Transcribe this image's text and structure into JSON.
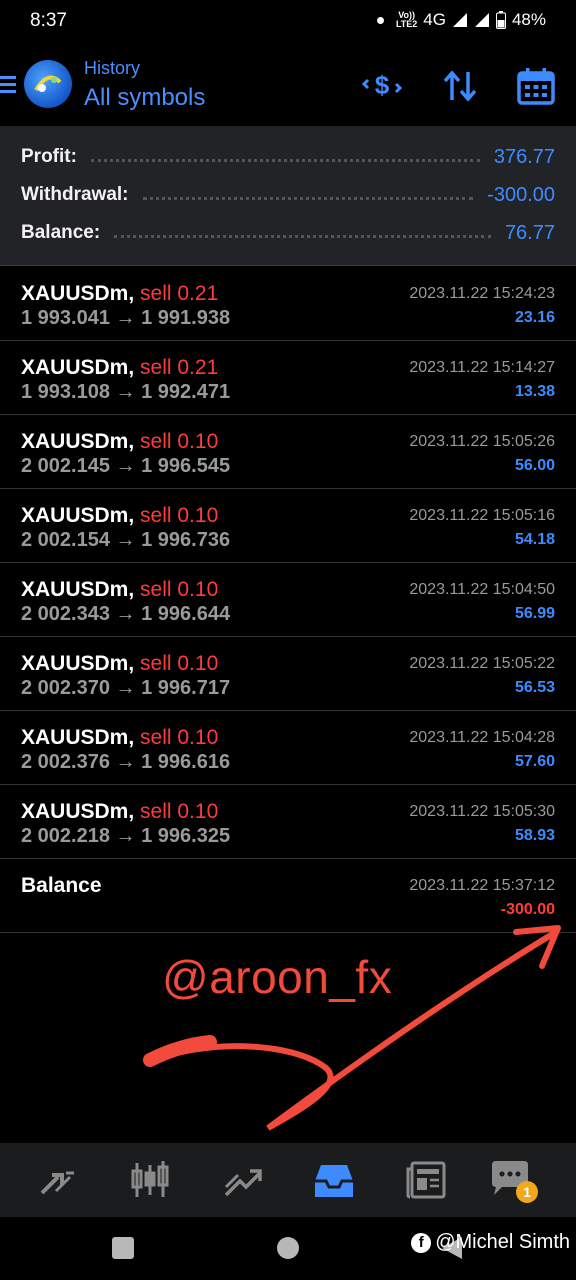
{
  "status": {
    "time": "8:37",
    "volte_top": "Vo))",
    "volte_bottom": "LTE2",
    "network": "4G",
    "battery": "48%"
  },
  "header": {
    "subtitle": "History",
    "title": "All symbols"
  },
  "summary": [
    {
      "label": "Profit:",
      "value": "376.77"
    },
    {
      "label": "Withdrawal:",
      "value": "-300.00"
    },
    {
      "label": "Balance:",
      "value": "76.77"
    }
  ],
  "trades": [
    {
      "symbol": "XAUUSDm,",
      "side": "sell 0.21",
      "prices": "1 993.041 → 1 991.938",
      "time": "2023.11.22 15:24:23",
      "profit": "23.16"
    },
    {
      "symbol": "XAUUSDm,",
      "side": "sell 0.21",
      "prices": "1 993.108 → 1 992.471",
      "time": "2023.11.22 15:14:27",
      "profit": "13.38"
    },
    {
      "symbol": "XAUUSDm,",
      "side": "sell 0.10",
      "prices": "2 002.145 → 1 996.545",
      "time": "2023.11.22 15:05:26",
      "profit": "56.00"
    },
    {
      "symbol": "XAUUSDm,",
      "side": "sell 0.10",
      "prices": "2 002.154 → 1 996.736",
      "time": "2023.11.22 15:05:16",
      "profit": "54.18"
    },
    {
      "symbol": "XAUUSDm,",
      "side": "sell 0.10",
      "prices": "2 002.343 → 1 996.644",
      "time": "2023.11.22 15:04:50",
      "profit": "56.99"
    },
    {
      "symbol": "XAUUSDm,",
      "side": "sell 0.10",
      "prices": "2 002.370 → 1 996.717",
      "time": "2023.11.22 15:05:22",
      "profit": "56.53"
    },
    {
      "symbol": "XAUUSDm,",
      "side": "sell 0.10",
      "prices": "2 002.376 → 1 996.616",
      "time": "2023.11.22 15:04:28",
      "profit": "57.60"
    },
    {
      "symbol": "XAUUSDm,",
      "side": "sell 0.10",
      "prices": "2 002.218 → 1 996.325",
      "time": "2023.11.22 15:05:30",
      "profit": "58.93"
    }
  ],
  "balance_entry": {
    "label": "Balance",
    "time": "2023.11.22 15:37:12",
    "amount": "-300.00"
  },
  "watermark": "@aroon_fx",
  "tabs": [
    {
      "name": "quotes-icon"
    },
    {
      "name": "chart-icon"
    },
    {
      "name": "trade-icon"
    },
    {
      "name": "history-icon",
      "active": true
    },
    {
      "name": "news-icon"
    },
    {
      "name": "messages-icon",
      "badge": "1"
    }
  ],
  "credit": "@Michel Simth",
  "colors": {
    "accent": "#3d8bff",
    "loss": "#ff3b3b",
    "annotation": "#f24a3c",
    "active_tab": "#3d8bff"
  }
}
